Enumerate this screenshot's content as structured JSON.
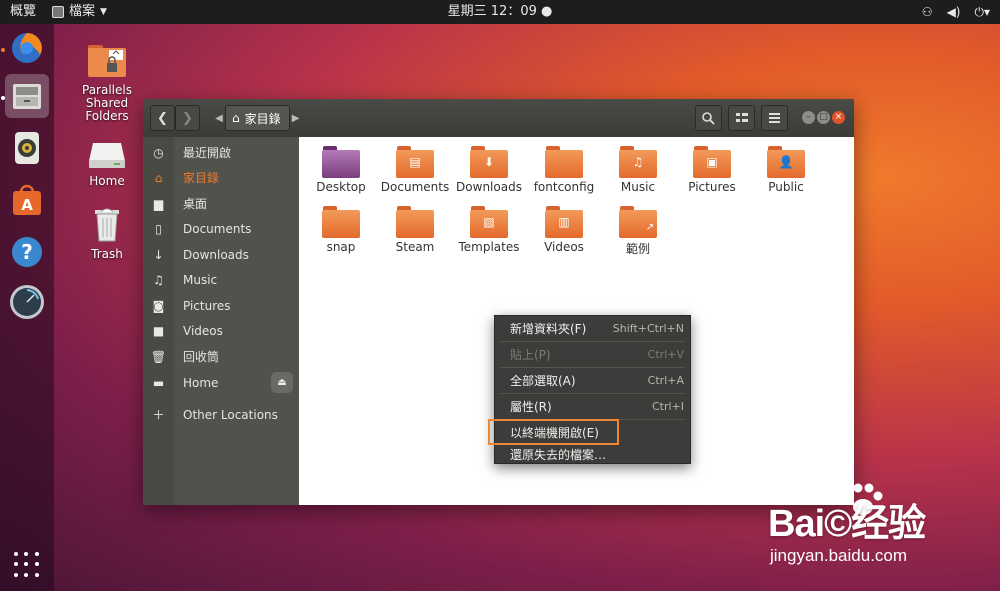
{
  "topbar": {
    "overview": "概覽",
    "app_menu": "檔案",
    "clock": "星期三 12：09",
    "icons": [
      "network-icon",
      "volume-icon",
      "power-icon"
    ]
  },
  "dock": {
    "items": [
      "firefox-icon",
      "files-icon",
      "rhythmbox-icon",
      "software-center-icon",
      "help-icon",
      "parallels-icon"
    ],
    "active": "files-icon"
  },
  "desktop": {
    "icons": [
      {
        "name": "Parallels Shared Folders",
        "line1": "Parallels",
        "line2": "Shared",
        "line3": "Folders"
      },
      {
        "name": "Home"
      },
      {
        "name": "Trash"
      }
    ]
  },
  "window": {
    "path_crumb": "家目錄",
    "sidebar": [
      {
        "label": "最近開啟",
        "icon": "clock-icon"
      },
      {
        "label": "家目錄",
        "icon": "home-icon",
        "selected": true
      },
      {
        "label": "桌面",
        "icon": "folder-icon"
      },
      {
        "label": "Documents",
        "icon": "document-icon"
      },
      {
        "label": "Downloads",
        "icon": "download-icon"
      },
      {
        "label": "Music",
        "icon": "music-icon"
      },
      {
        "label": "Pictures",
        "icon": "camera-icon"
      },
      {
        "label": "Videos",
        "icon": "video-icon"
      },
      {
        "label": "回收筒",
        "icon": "trash-icon"
      },
      {
        "label": "Home",
        "icon": "drive-icon"
      },
      {
        "label": "Other Locations",
        "icon": "plus-icon"
      }
    ],
    "folders": [
      {
        "label": "Desktop"
      },
      {
        "label": "Documents"
      },
      {
        "label": "Downloads"
      },
      {
        "label": "fontconfig"
      },
      {
        "label": "Music"
      },
      {
        "label": "Pictures"
      },
      {
        "label": "Public"
      },
      {
        "label": "snap"
      },
      {
        "label": "Steam"
      },
      {
        "label": "Templates"
      },
      {
        "label": "Videos"
      },
      {
        "label": "範例"
      }
    ]
  },
  "context_menu": {
    "items": [
      {
        "label": "新增資料夾(F)",
        "accel": "Shift+Ctrl+N"
      },
      {
        "label": "貼上(P)",
        "accel": "Ctrl+V",
        "disabled": true
      },
      {
        "label": "全部選取(A)",
        "accel": "Ctrl+A"
      },
      {
        "label": "屬性(R)",
        "accel": "Ctrl+I"
      },
      {
        "label": "以終端機開啟(E)",
        "accel": ""
      },
      {
        "label": "還原失去的檔案…",
        "accel": ""
      }
    ],
    "highlight_color": "#ee8532"
  },
  "watermark": {
    "brand": "Bai©经验",
    "url": "jingyan.baidu.com"
  },
  "colors": {
    "accent": "#f07a2c",
    "topbar": "#1d1d1d",
    "headerbar": "#3b3b38",
    "sidebar": "#52524d",
    "menu": "#3c3c3a"
  }
}
